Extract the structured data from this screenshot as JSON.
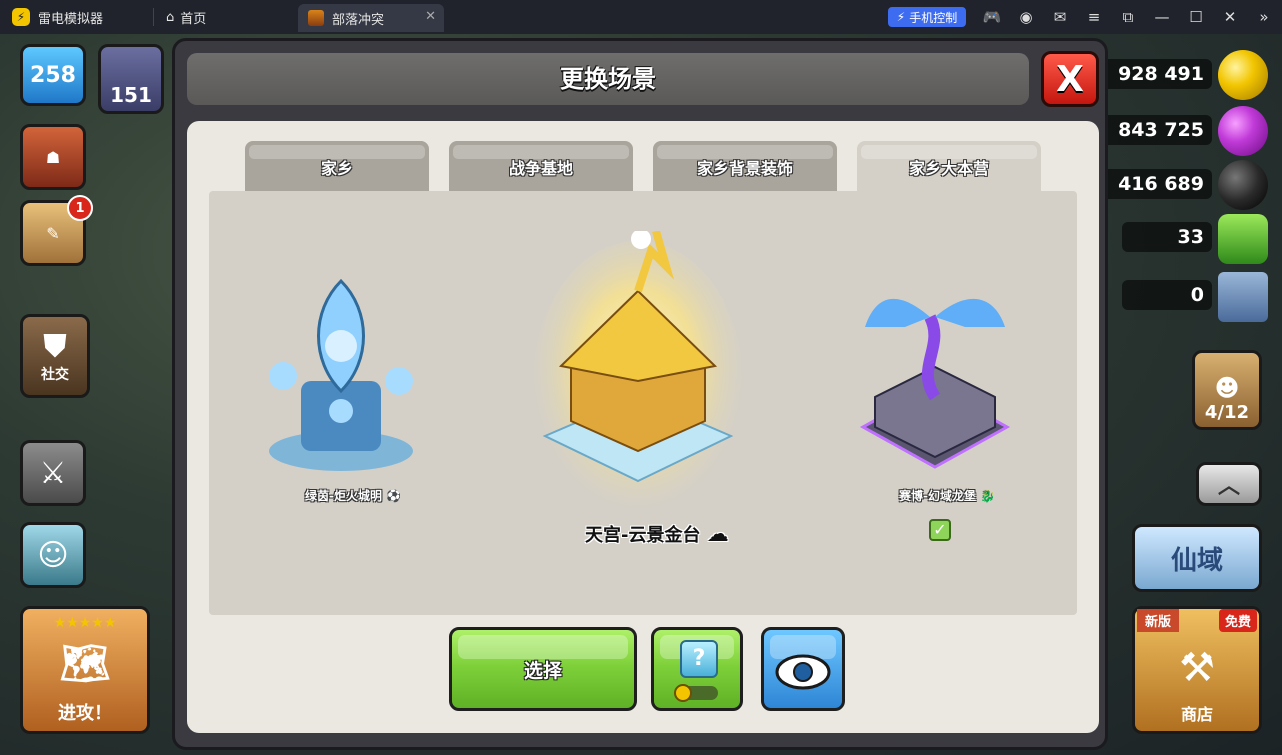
{
  "emulator": {
    "app_name": "雷电模拟器",
    "home_label": "首页",
    "active_tab": "部落冲突",
    "phone_control": "手机控制"
  },
  "hud": {
    "trophies": "258",
    "level_badge": "151",
    "notification_count": "1",
    "social_label": "社交",
    "attack_label": "进攻！",
    "resources": {
      "gold": "928 491",
      "elixir": "843 725",
      "dark_elixir": "416 689",
      "gems": "33",
      "other": "0"
    },
    "builders": "4/12",
    "shop_new_tag": "新版",
    "shop_free_tag": "免费",
    "shop_label": "商店",
    "event_label": "仙域"
  },
  "dialog": {
    "title": "更换场景",
    "close_label": "X",
    "tabs": [
      {
        "label": "家乡",
        "active": false
      },
      {
        "label": "战争基地",
        "active": false
      },
      {
        "label": "家乡背景装饰",
        "active": false
      },
      {
        "label": "家乡大本营",
        "active": true
      }
    ],
    "scenes": {
      "left": "绿茵-炬火城明",
      "center": "天宫-云景金台",
      "right": "赛博-幻域龙堡"
    },
    "select_label": "选择"
  },
  "colors": {
    "accent_green": "#7fd13a",
    "accent_blue": "#2e86d6",
    "close_red": "#d8261a",
    "gold": "#f2c500"
  }
}
